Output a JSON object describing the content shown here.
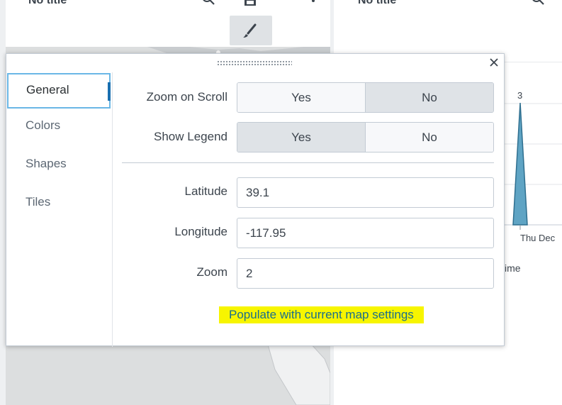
{
  "left_panel": {
    "title": "No title"
  },
  "right_panel": {
    "title": "No title",
    "chart_peak_label": "3",
    "x_tick_label": "Thu Dec",
    "x_axis_partial_label": "ime"
  },
  "modal": {
    "sidebar": [
      {
        "label": "General",
        "active": true
      },
      {
        "label": "Colors",
        "active": false
      },
      {
        "label": "Shapes",
        "active": false
      },
      {
        "label": "Tiles",
        "active": false
      }
    ],
    "zoom_on_scroll": {
      "label": "Zoom on Scroll",
      "options": [
        "Yes",
        "No"
      ],
      "selected": "No"
    },
    "show_legend": {
      "label": "Show Legend",
      "options": [
        "Yes",
        "No"
      ],
      "selected": "Yes"
    },
    "latitude": {
      "label": "Latitude",
      "value": "39.1"
    },
    "longitude": {
      "label": "Longitude",
      "value": "-117.95"
    },
    "zoom": {
      "label": "Zoom",
      "value": "2"
    },
    "populate_link": "Populate with current map settings"
  },
  "colors": {
    "accent": "#1a6fb0",
    "highlight": "#f7f500",
    "chart_fill": "#5fa4c4",
    "selected_toggle": "#dfe3e7"
  },
  "icons": [
    "search-icon",
    "save-icon",
    "more-vertical-icon",
    "paintbrush-icon",
    "close-icon",
    "drag-handle-icon"
  ]
}
